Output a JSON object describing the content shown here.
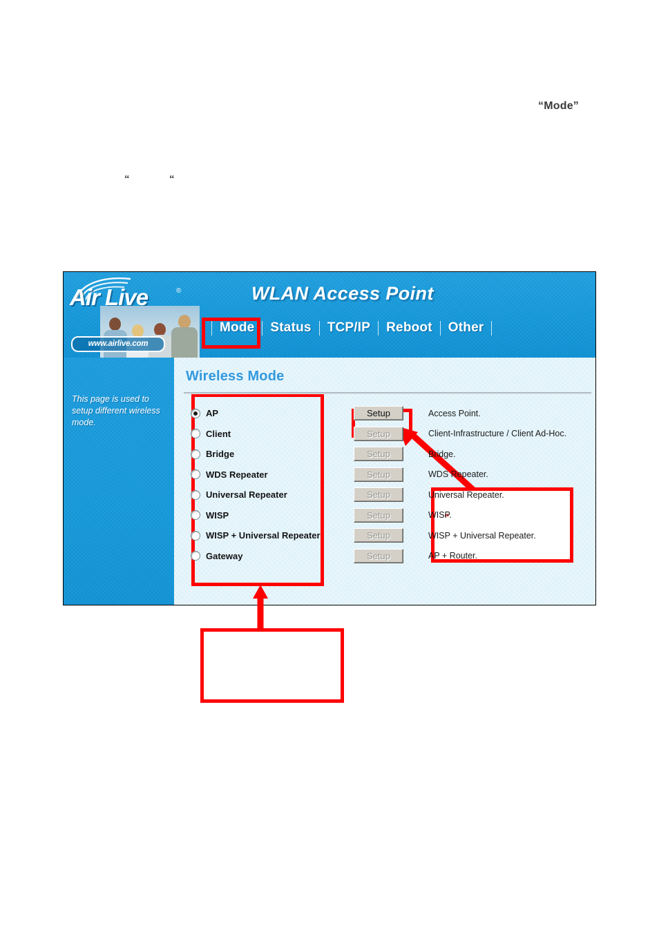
{
  "document": {
    "note_mode": "“Mode”",
    "note_blank": "“         “"
  },
  "router_ui": {
    "brand": {
      "name": "Air Live",
      "registered_mark": "®",
      "url": "www.airlive.com",
      "wifi_icon": "wifi-arcs-icon"
    },
    "product_title": "WLAN Access Point",
    "nav_tabs": [
      {
        "label": "Mode",
        "active": true
      },
      {
        "label": "Status",
        "active": false
      },
      {
        "label": "TCP/IP",
        "active": false
      },
      {
        "label": "Reboot",
        "active": false
      },
      {
        "label": "Other",
        "active": false
      }
    ],
    "side_panel": {
      "help_text": "This page is used to setup different wireless mode."
    },
    "page_heading": "Wireless Mode",
    "modes": [
      {
        "label": "AP",
        "selected": true,
        "setup_label": "Setup",
        "setup_enabled": true,
        "description": "Access Point."
      },
      {
        "label": "Client",
        "selected": false,
        "setup_label": "Setup",
        "setup_enabled": false,
        "description": "Client-Infrastructure / Client Ad-Hoc."
      },
      {
        "label": "Bridge",
        "selected": false,
        "setup_label": "Setup",
        "setup_enabled": false,
        "description": "Bridge."
      },
      {
        "label": "WDS Repeater",
        "selected": false,
        "setup_label": "Setup",
        "setup_enabled": false,
        "description": "WDS Repeater."
      },
      {
        "label": "Universal Repeater",
        "selected": false,
        "setup_label": "Setup",
        "setup_enabled": false,
        "description": "Universal Repeater."
      },
      {
        "label": "WISP",
        "selected": false,
        "setup_label": "Setup",
        "setup_enabled": false,
        "description": "WISP."
      },
      {
        "label": "WISP + Universal Repeater",
        "selected": false,
        "setup_label": "Setup",
        "setup_enabled": false,
        "description": "WISP + Universal Repeater."
      },
      {
        "label": "Gateway",
        "selected": false,
        "setup_label": "Setup",
        "setup_enabled": false,
        "description": "AP + Router."
      }
    ]
  },
  "annotations": {
    "accent_color": "#ff0000",
    "callout_right": {
      "text": "“              ”"
    },
    "callout_bottom": {
      "text": ""
    }
  },
  "colors": {
    "header_blue": "#1597d8",
    "content_blue": "#e8f6fc",
    "heading_blue": "#3399dd",
    "button_face": "#d4d0c8",
    "annotation_red": "#ff0000"
  }
}
